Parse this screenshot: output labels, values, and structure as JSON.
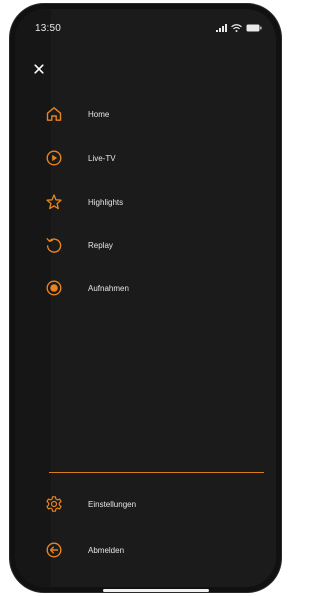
{
  "status_bar": {
    "time": "13:50",
    "icons": [
      "signal-icon",
      "wifi-icon",
      "battery-icon"
    ]
  },
  "colors": {
    "accent": "#E8831F",
    "background": "#1B1B1B",
    "text": "#E6E6E6"
  },
  "close_button": {
    "icon": "close-icon",
    "label": "×"
  },
  "menu": {
    "items": [
      {
        "label": "Home",
        "icon": "home-icon"
      },
      {
        "label": "Live-TV",
        "icon": "play-circle-icon"
      },
      {
        "label": "Highlights",
        "icon": "star-icon"
      },
      {
        "label": "Replay",
        "icon": "replay-icon"
      },
      {
        "label": "Aufnahmen",
        "icon": "record-icon"
      }
    ],
    "footer_items": [
      {
        "label": "Einstellungen",
        "icon": "gear-icon"
      },
      {
        "label": "Abmelden",
        "icon": "logout-icon"
      }
    ]
  }
}
